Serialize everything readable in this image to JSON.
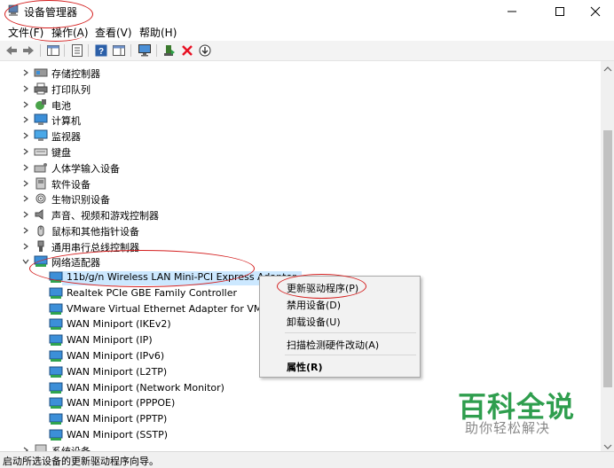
{
  "window": {
    "title": "设备管理器"
  },
  "menu": [
    "文件(F)",
    "操作(A)",
    "查看(V)",
    "帮助(H)"
  ],
  "tree": {
    "categories": [
      {
        "label": "存储控制器",
        "icon": "storage-icon"
      },
      {
        "label": "打印队列",
        "icon": "printer-icon"
      },
      {
        "label": "电池",
        "icon": "battery-icon"
      },
      {
        "label": "计算机",
        "icon": "computer-icon"
      },
      {
        "label": "监视器",
        "icon": "monitor-icon"
      },
      {
        "label": "键盘",
        "icon": "keyboard-icon"
      },
      {
        "label": "人体学输入设备",
        "icon": "hid-icon"
      },
      {
        "label": "软件设备",
        "icon": "software-device-icon"
      },
      {
        "label": "生物识别设备",
        "icon": "fingerprint-icon"
      },
      {
        "label": "声音、视频和游戏控制器",
        "icon": "speaker-icon"
      },
      {
        "label": "鼠标和其他指针设备",
        "icon": "mouse-icon"
      },
      {
        "label": "通用串行总线控制器",
        "icon": "usb-icon"
      }
    ],
    "expanded": {
      "label": "网络适配器",
      "icon": "network-adapter-icon"
    },
    "children": [
      "11b/g/n  Wireless LAN Mini-PCI Express Adapter",
      "Realtek PCIe GBE Family Controller",
      "VMware Virtual Ethernet Adapter for VMnet",
      "WAN Miniport (IKEv2)",
      "WAN Miniport (IP)",
      "WAN Miniport (IPv6)",
      "WAN Miniport (L2TP)",
      "WAN Miniport (Network Monitor)",
      "WAN Miniport (PPPOE)",
      "WAN Miniport (PPTP)",
      "WAN Miniport (SSTP)"
    ],
    "next_partial": "系统设备"
  },
  "context_menu": {
    "update_driver": "更新驱动程序(P)",
    "disable_device": "禁用设备(D)",
    "uninstall_device": "卸载设备(U)",
    "scan_hardware": "扫描检测硬件改动(A)",
    "properties": "属性(R)"
  },
  "status": {
    "text": "启动所选设备的更新驱动程序向导。"
  },
  "watermark": {
    "big": "百科全说",
    "small": "助你轻松解决"
  },
  "colors": {
    "selection": "#cce8ff",
    "annotation": "#d41f1f",
    "watermark": "#2f9e4e",
    "delete_icon": "#e81123"
  }
}
